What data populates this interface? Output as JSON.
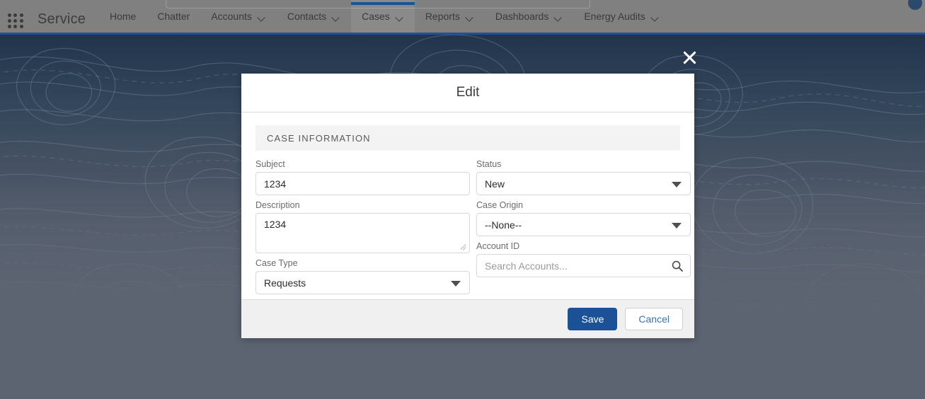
{
  "nav": {
    "app_name": "Service",
    "app_launcher_icon": "app-launcher-grid-icon",
    "items": [
      {
        "label": "Home",
        "has_chevron": false,
        "active": false
      },
      {
        "label": "Chatter",
        "has_chevron": false,
        "active": false
      },
      {
        "label": "Accounts",
        "has_chevron": true,
        "active": false
      },
      {
        "label": "Contacts",
        "has_chevron": true,
        "active": false
      },
      {
        "label": "Cases",
        "has_chevron": true,
        "active": true
      },
      {
        "label": "Reports",
        "has_chevron": true,
        "active": false
      },
      {
        "label": "Dashboards",
        "has_chevron": true,
        "active": false
      },
      {
        "label": "Energy Audits",
        "has_chevron": true,
        "active": false
      }
    ]
  },
  "modal": {
    "title": "Edit",
    "close_icon": "close-x-icon",
    "section_title": "CASE INFORMATION",
    "fields": {
      "subject": {
        "label": "Subject",
        "value": "1234"
      },
      "description": {
        "label": "Description",
        "value": "1234"
      },
      "case_type": {
        "label": "Case Type",
        "value": "Requests"
      },
      "status": {
        "label": "Status",
        "value": "New"
      },
      "case_origin": {
        "label": "Case Origin",
        "value": "--None--"
      },
      "account_id": {
        "label": "Account ID",
        "value": "",
        "placeholder": "Search Accounts...",
        "icon": "search-icon"
      }
    },
    "footer": {
      "save_label": "Save",
      "cancel_label": "Cancel"
    }
  },
  "colors": {
    "primary_blue": "#1b5297",
    "nav_accent": "#1d5495",
    "link_blue": "#3a74b8",
    "nav_bar": "#808080",
    "page_bg": "#5c6472"
  }
}
